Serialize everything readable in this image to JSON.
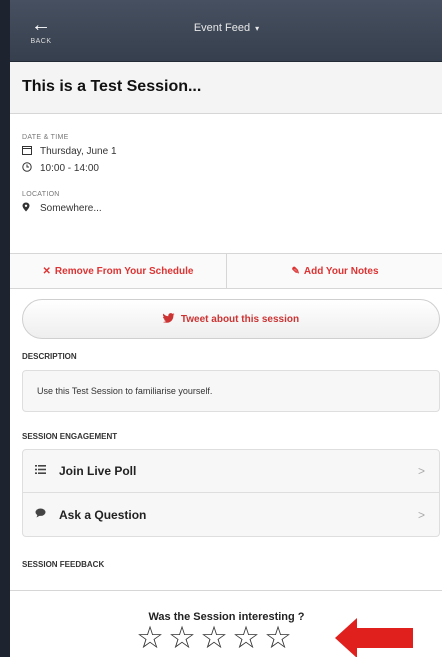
{
  "nav": {
    "back_icon": "←",
    "back_label": "BACK",
    "title": "Event Feed",
    "title_caret": "▾"
  },
  "session": {
    "title": "This is a Test Session..."
  },
  "details": {
    "datetime_label": "DATE & TIME",
    "date": "Thursday, June 1",
    "time": "10:00 - 14:00",
    "location_label": "LOCATION",
    "location": "Somewhere..."
  },
  "actions": {
    "remove_label": "Remove From Your Schedule",
    "notes_label": "Add Your Notes"
  },
  "tweet_label": "Tweet about this session",
  "description": {
    "header": "DESCRIPTION",
    "text": "Use this Test Session to familiarise yourself."
  },
  "engagement": {
    "header": "SESSION ENGAGEMENT",
    "items": [
      {
        "label": "Join Live Poll",
        "icon": "list-icon"
      },
      {
        "label": "Ask a Question",
        "icon": "speech-bubble-icon"
      }
    ]
  },
  "feedback": {
    "header": "SESSION FEEDBACK",
    "question": "Was the Session interesting ?",
    "star_count": 5,
    "rating": 0
  },
  "colors": {
    "nav_bg": "#3d4654",
    "accent_red": "#d33333",
    "annotation_red": "#e0201d"
  }
}
